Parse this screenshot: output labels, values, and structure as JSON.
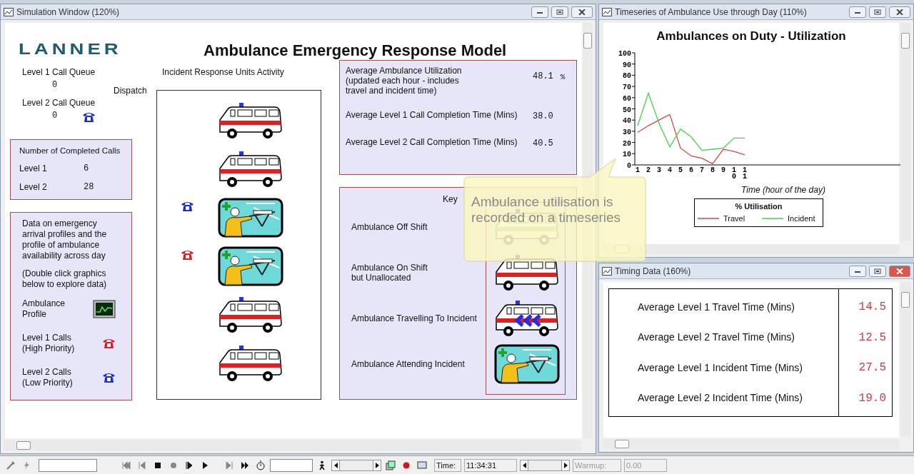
{
  "simulation_window": {
    "title": "Simulation Window (120%)",
    "logo": "LANNER",
    "heading": "Ambulance Emergency Response Model",
    "queues": [
      {
        "label": "Level 1 Call Queue",
        "value": "0"
      },
      {
        "label": "Level 2 Call Queue",
        "value": "0"
      }
    ],
    "dispatch": {
      "label": "Dispatch",
      "color": "#1a2fd0"
    },
    "completed_calls": {
      "title": "Number of Completed Calls",
      "rows": [
        {
          "label": "Level 1",
          "value": "6"
        },
        {
          "label": "Level 2",
          "value": "28"
        }
      ]
    },
    "data_panel": {
      "description": "Data on emergency arrival profiles and the profile of ambulance availability across day",
      "instruction": "(Double click graphics below to explore data)",
      "items": [
        {
          "kind": "profile",
          "lines": [
            "Ambulance",
            "Profile"
          ]
        },
        {
          "kind": "call",
          "lines": [
            "Level 1 Calls",
            "(High Priority)"
          ],
          "color": "#e02020"
        },
        {
          "kind": "call",
          "lines": [
            "Level 2 Calls",
            "(Low Priority)"
          ],
          "color": "#1a2fd0"
        }
      ]
    },
    "activity": {
      "title": "Incident Response Units Activity",
      "units": [
        {
          "kind": "ambulance"
        },
        {
          "kind": "ambulance"
        },
        {
          "kind": "attending",
          "color": "#1a2fd0"
        },
        {
          "kind": "attending",
          "color": "#e02020"
        },
        {
          "kind": "ambulance"
        },
        {
          "kind": "ambulance"
        }
      ]
    },
    "statistics": [
      {
        "lines": [
          "Average Ambulance Utilization",
          "(updated each hour - includes",
          "travel and incident time)"
        ],
        "value": "48.1",
        "unit": "%"
      },
      {
        "lines": [
          "Average Level 1 Call Completion Time (Mins)"
        ],
        "value": "38.0"
      },
      {
        "lines": [
          "Average Level 2 Call Completion Time (Mins)"
        ],
        "value": "40.5"
      }
    ],
    "key": {
      "title": "Key",
      "items": [
        {
          "kind": "off_shift",
          "lines": [
            "Ambulance Off Shift"
          ]
        },
        {
          "kind": "ambulance",
          "lines": [
            "Ambulance On Shift",
            "but Unallocated"
          ]
        },
        {
          "kind": "travelling",
          "lines": [
            "Ambulance Travelling To Incident"
          ]
        },
        {
          "kind": "attending",
          "lines": [
            "Ambulance Attending Incident"
          ]
        }
      ]
    }
  },
  "callout": {
    "lines": [
      "Ambulance utilisation is",
      "recorded on a timeseries"
    ]
  },
  "timeseries_window": {
    "title": "Timeseries of Ambulance Use through Day (110%)",
    "legend_title": "% Utilisation",
    "chart_data": {
      "type": "line",
      "title": "Ambulances on Duty - Utilization",
      "xlabel": "Time (hour of the day)",
      "categories": [
        "1",
        "2",
        "3",
        "4",
        "5",
        "6",
        "7",
        "8",
        "9",
        "10",
        "11"
      ],
      "ylim": [
        0,
        100
      ],
      "yticks": [
        0,
        10,
        20,
        30,
        40,
        50,
        60,
        70,
        80,
        90,
        100
      ],
      "series": [
        {
          "name": "Travel",
          "color": "#d04848",
          "values": [
            29,
            35,
            40,
            45,
            15,
            8,
            6,
            1,
            14,
            12,
            9
          ]
        },
        {
          "name": "Incident",
          "color": "#48d048",
          "values": [
            35,
            64,
            37,
            16,
            32,
            25,
            13,
            14,
            15,
            24,
            24
          ]
        }
      ]
    }
  },
  "timing_window": {
    "title": "Timing Data  (160%)",
    "rows": [
      {
        "label": "Average Level 1 Travel Time (Mins)",
        "value": "14.5"
      },
      {
        "label": "Average Level 2 Travel Time (Mins)",
        "value": "12.5"
      },
      {
        "label": "Average Level 1 Incident Time (Mins)",
        "value": "27.5"
      },
      {
        "label": "Average Level 2 Incident Time (Mins)",
        "value": "19.0"
      }
    ]
  },
  "toolbar": {
    "time_label": "Time:",
    "time": "11:34:31",
    "warmup_label": "Warmup:",
    "warmup": "0.00"
  }
}
